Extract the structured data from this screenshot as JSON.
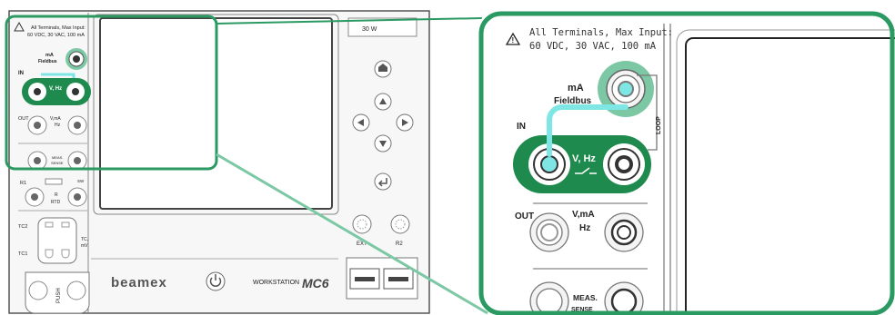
{
  "warning": {
    "line1": "All Terminals, Max Input:",
    "line2": "60 VDC, 30 VAC, 100 mA"
  },
  "terminals": {
    "ma_fieldbus_line1": "mA",
    "ma_fieldbus_line2": "Fieldbus",
    "loop": "LOOP",
    "in": "IN",
    "v_hz": "V, Hz",
    "out": "OUT",
    "vma_line1": "V,mA",
    "vma_line2": "Hz",
    "meas_line1": "MEAS.",
    "meas_line2": "SENSE",
    "r1": "R1",
    "r_rtd_line1": "R",
    "r_rtd_line2": "RTD",
    "sw": "SW",
    "tc2": "TC2",
    "tc1": "TC1",
    "tc_mv_line1": "TC,",
    "tc_mv_line2": "mV",
    "push": "PUSH"
  },
  "device": {
    "brand": "beamex",
    "model_prefix": "WORKSTATION",
    "model": "MC6",
    "top_right_label": "30 W",
    "ext_label": "EXT",
    "r2_label": "R2"
  },
  "colors": {
    "green": "#1e8a4e",
    "highlight": "#2a9a62",
    "cable": "#7fe6e6",
    "tip": "#7cc8a4"
  }
}
